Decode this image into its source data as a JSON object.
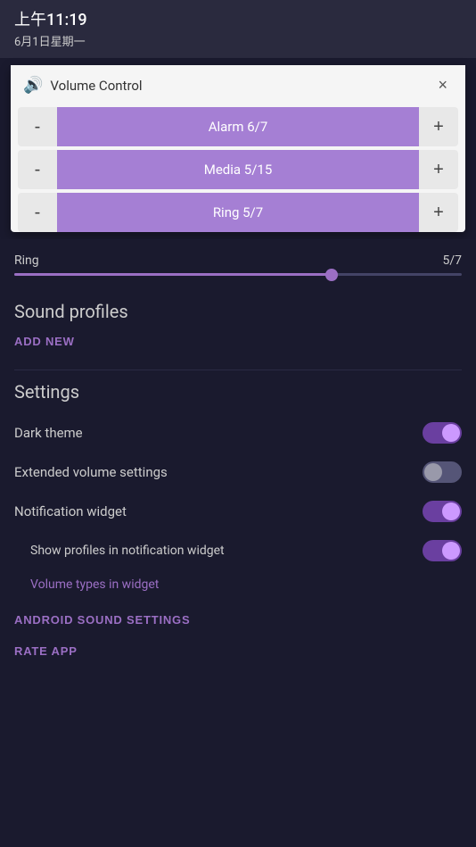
{
  "statusBar": {
    "time": "上午11:19",
    "date": "6月1日星期一"
  },
  "volumePopup": {
    "title": "Volume Control",
    "closeLabel": "×",
    "rows": [
      {
        "label": "Alarm 6/7",
        "minus": "-",
        "plus": "+"
      },
      {
        "label": "Media 5/15",
        "minus": "-",
        "plus": "+"
      },
      {
        "label": "Ring 5/7",
        "minus": "-",
        "plus": "+"
      }
    ]
  },
  "sliders": [
    {
      "label": "Ring",
      "value": "5/7",
      "fillPercent": 71
    }
  ],
  "soundProfiles": {
    "title": "Sound profiles",
    "addNew": "ADD NEW"
  },
  "settings": {
    "title": "Settings",
    "items": [
      {
        "id": "dark-theme",
        "label": "Dark theme",
        "toggleOn": true
      },
      {
        "id": "extended-volume",
        "label": "Extended volume settings",
        "toggleOn": false
      },
      {
        "id": "notification-widget",
        "label": "Notification widget",
        "toggleOn": true
      },
      {
        "id": "show-profiles",
        "label": "Show profiles in notification widget",
        "toggleOn": true,
        "indented": true
      }
    ],
    "volumeTypesLink": "Volume types in widget",
    "androidSoundSettings": "ANDROID SOUND SETTINGS",
    "rateApp": "RATE APP"
  }
}
